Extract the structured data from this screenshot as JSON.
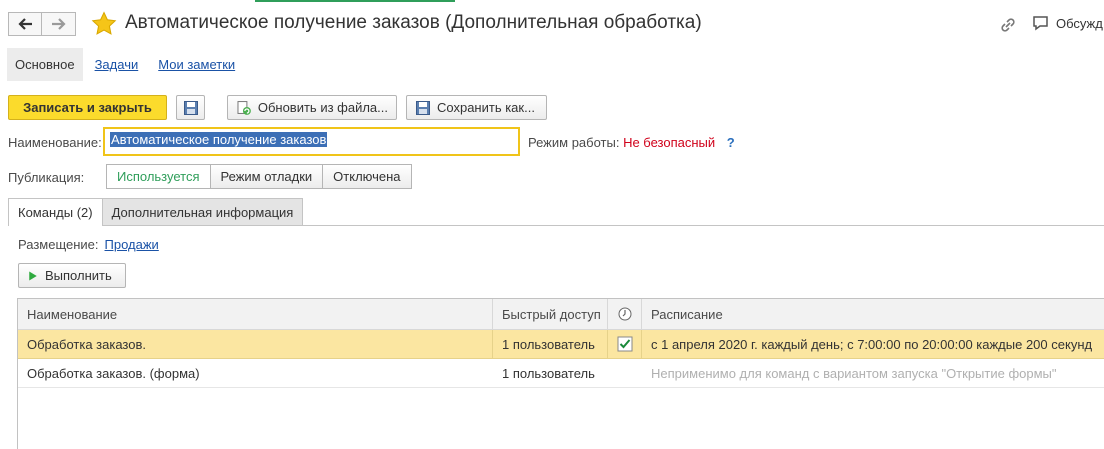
{
  "window": {
    "title": "Автоматическое получение заказов (Дополнительная обработка)",
    "discuss_label": "Обсужд"
  },
  "icons": {
    "back": "arrow-left-icon",
    "forward": "arrow-right-icon",
    "favorite": "star-icon",
    "link": "link-icon",
    "discuss": "chat-icon",
    "save": "floppy-icon",
    "update": "update-from-file-icon",
    "save_as": "save-as-icon",
    "run": "play-icon",
    "clock": "clock-icon",
    "check": "checkbox-checked-icon"
  },
  "colors": {
    "accent_yellow": "#fbdb2c",
    "active_green": "#2f9e5a",
    "warning_red": "#d0021b",
    "link_blue": "#1a52a6",
    "selected_row": "#fbe6a1"
  },
  "sections": {
    "main": "Основное",
    "tasks": "Задачи",
    "notes": "Мои заметки"
  },
  "toolbar": {
    "save_close": "Записать и закрыть",
    "update_from_file": "Обновить из файла...",
    "save_as": "Сохранить как..."
  },
  "form": {
    "name_label": "Наименование:",
    "name_value": "Автоматическое получение заказов",
    "mode_label": "Режим работы:",
    "mode_value": "Не безопасный",
    "help": "?",
    "publication_label": "Публикация:",
    "publication_options": [
      "Используется",
      "Режим отладки",
      "Отключена"
    ],
    "publication_selected": "Используется"
  },
  "tabs": {
    "commands": "Команды (2)",
    "additional": "Дополнительная информация"
  },
  "commands": {
    "placement_label": "Размещение:",
    "placement_value": "Продажи",
    "run_button": "Выполнить",
    "columns": [
      "Наименование",
      "Быстрый доступ",
      "",
      "Расписание"
    ],
    "rows": [
      {
        "name": "Обработка заказов.",
        "quick_access": "1 пользователь",
        "scheduled": true,
        "schedule": "с 1 апреля 2020 г. каждый день; с 7:00:00 по 20:00:00 каждые 200 секунд"
      },
      {
        "name": "Обработка заказов. (форма)",
        "quick_access": "1 пользователь",
        "scheduled": false,
        "schedule": "Неприменимо для команд с вариантом запуска \"Открытие формы\""
      }
    ]
  }
}
